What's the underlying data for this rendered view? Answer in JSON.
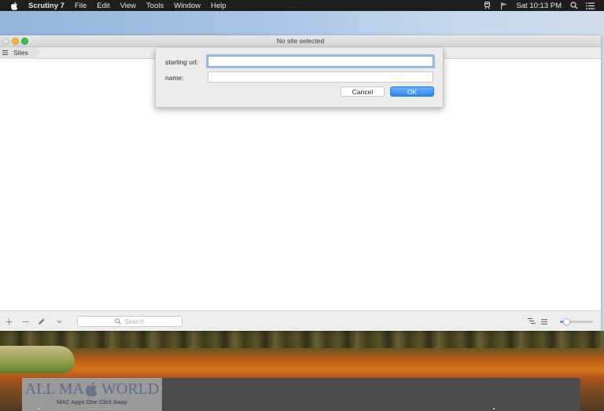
{
  "menubar": {
    "app_name": "Scrutiny 7",
    "menus": [
      "File",
      "Edit",
      "View",
      "Tools",
      "Window",
      "Help"
    ],
    "status_icons": [
      "train-icon",
      "flag-icon"
    ],
    "clock": "Sat 10:13 PM"
  },
  "window": {
    "title": "No site selected",
    "breadcrumb": "Sites",
    "search_placeholder": "Search"
  },
  "sheet": {
    "starting_url_label": "starting url:",
    "starting_url_value": "",
    "name_label": "name:",
    "name_value": "",
    "cancel_label": "Cancel",
    "ok_label": "OK"
  },
  "toolbar": {
    "zoom_slider_fraction": 0.2
  },
  "watermark": {
    "logo_left": "ALL MA",
    "logo_right": "WORLD",
    "tagline": "MAC Apps One Click Away"
  },
  "colors": {
    "accent": "#2f86f4",
    "close": "#e0e0e0",
    "minimize": "#f5b731",
    "maximize": "#35c348"
  }
}
